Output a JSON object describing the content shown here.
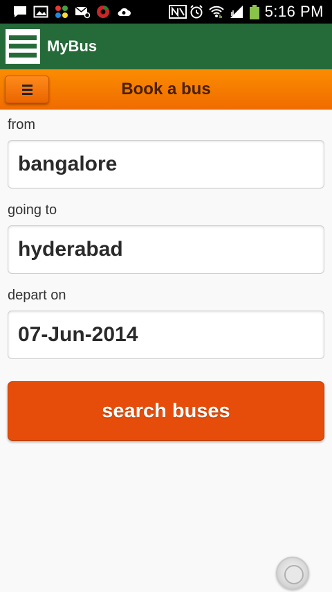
{
  "status_bar": {
    "time": "5:16 PM",
    "left_icons": [
      "message-icon",
      "image-icon",
      "apps-icon",
      "email-icon",
      "browser-icon",
      "cloud-icon"
    ],
    "right_icons": [
      "nfc-icon",
      "alarm-icon",
      "wifi-icon",
      "signal-icon",
      "battery-icon"
    ],
    "battery_color": "#8bc34a"
  },
  "app_bar": {
    "title": "MyBus",
    "color": "#256b3a"
  },
  "header": {
    "title": "Book a bus",
    "color": "#f57c00"
  },
  "form": {
    "from_label": "from",
    "from_value": "bangalore",
    "to_label": "going to",
    "to_value": "hyderabad",
    "depart_label": "depart on",
    "depart_value": "07-Jun-2014",
    "search_label": "search buses",
    "search_color": "#e64d0a"
  }
}
